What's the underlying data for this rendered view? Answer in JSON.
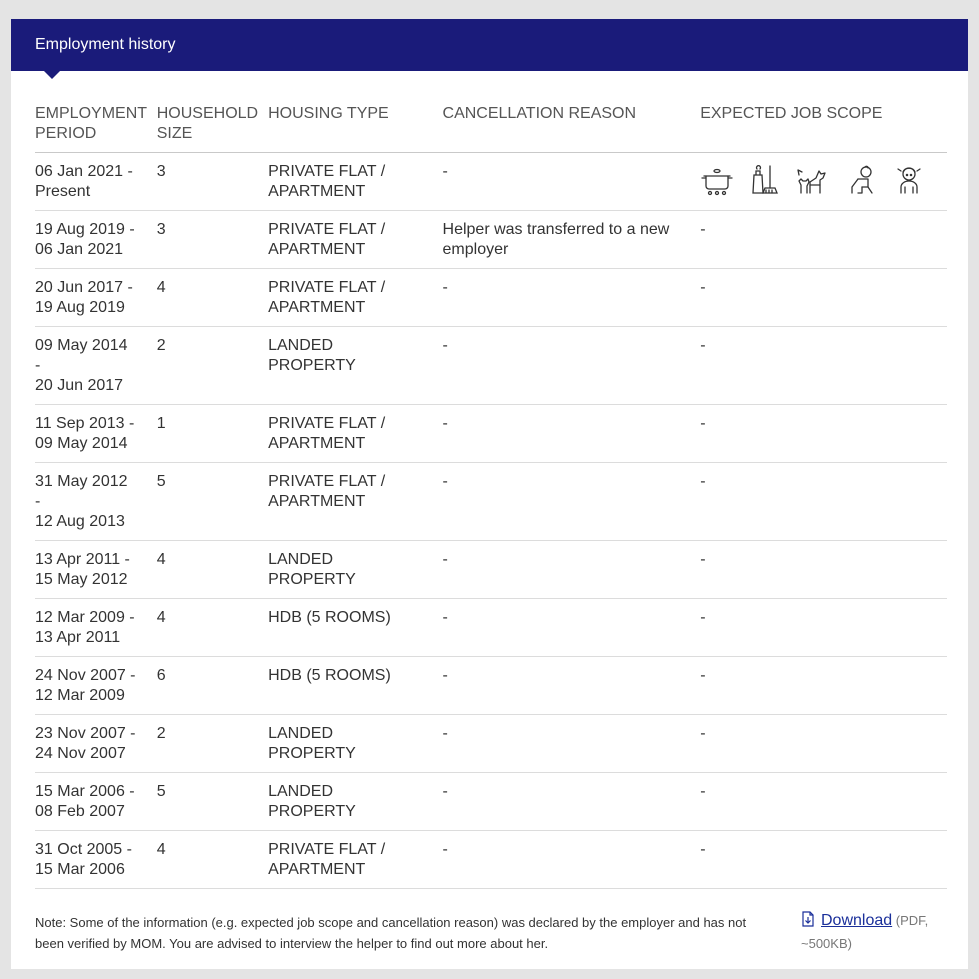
{
  "panel": {
    "title": "Employment history"
  },
  "table": {
    "headers": [
      "EMPLOYMENT PERIOD",
      "HOUSEHOLD SIZE",
      "HOUSING TYPE",
      "CANCELLATION REASON",
      "EXPECTED JOB SCOPE"
    ],
    "rows": [
      [
        "06 Jan 2021 - Present",
        "3",
        "PRIVATE FLAT / APARTMENT",
        "-",
        ""
      ],
      [
        "19 Aug 2019 - 06 Jan 2021",
        "3",
        "PRIVATE FLAT / APARTMENT",
        "Helper was transferred to a new employer",
        "-"
      ],
      [
        "20 Jun 2017 - 19 Aug 2019",
        "4",
        "PRIVATE FLAT / APARTMENT",
        "-",
        "-"
      ],
      [
        "09 May 2014\n-\n20 Jun 2017",
        "2",
        "LANDED PROPERTY",
        "-",
        "-"
      ],
      [
        "11 Sep 2013 - 09 May 2014",
        "1",
        "PRIVATE FLAT / APARTMENT",
        "-",
        "-"
      ],
      [
        "31 May 2012\n-\n12 Aug 2013",
        "5",
        "PRIVATE FLAT / APARTMENT",
        "-",
        "-"
      ],
      [
        "13 Apr 2011 - 15 May 2012",
        "4",
        "LANDED PROPERTY",
        "-",
        "-"
      ],
      [
        "12 Mar 2009 - 13 Apr 2011",
        "4",
        "HDB (5 ROOMS)",
        "-",
        "-"
      ],
      [
        "24 Nov 2007 - 12 Mar 2009",
        "6",
        "HDB (5 ROOMS)",
        "-",
        "-"
      ],
      [
        "23 Nov 2007 - 24 Nov 2007",
        "2",
        "LANDED PROPERTY",
        "-",
        "-"
      ],
      [
        "15 Mar 2006 - 08 Feb 2007",
        "5",
        "LANDED PROPERTY",
        "-",
        "-"
      ],
      [
        "31 Oct 2005 - 15 Mar 2006",
        "4",
        "PRIVATE FLAT / APARTMENT",
        "-",
        "-"
      ]
    ],
    "job_scope_icons": [
      "cooking-pot-icon",
      "cleaning-icon",
      "pet-care-icon",
      "infant-care-icon",
      "child-care-icon"
    ]
  },
  "footer": {
    "note": "Note: Some of the information (e.g. expected job scope and cancellation reason) was declared by the employer and has not been verified by MOM. You are advised to interview the helper to find out more about her.",
    "download_label": "Download",
    "download_meta": "(PDF, ~500KB)"
  },
  "colors": {
    "header_bg": "#1a1b7a",
    "link": "#1a2f9a"
  }
}
